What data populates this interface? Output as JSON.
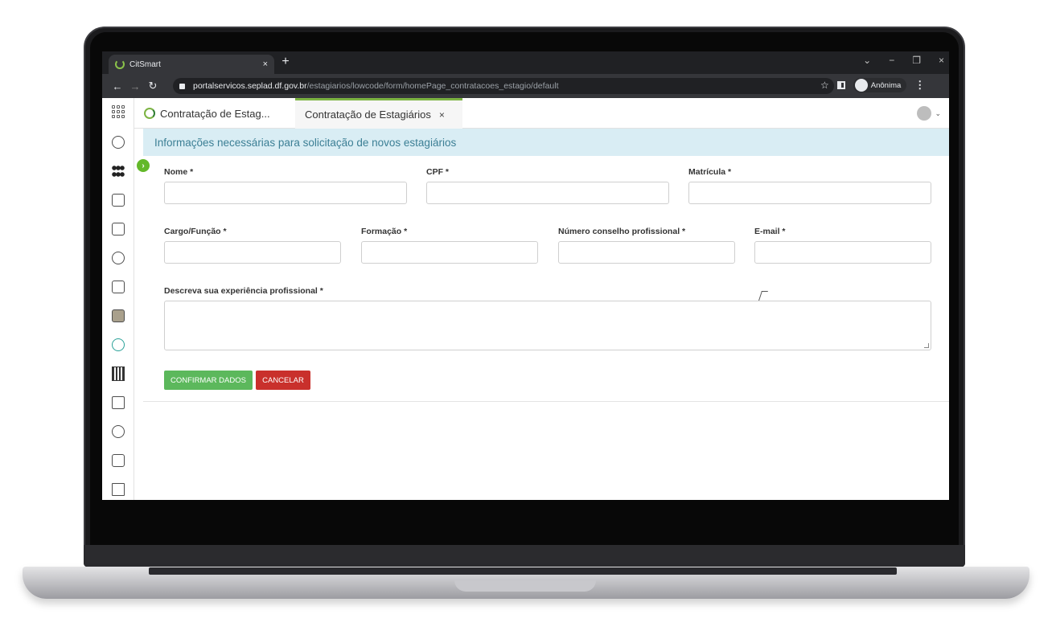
{
  "browser": {
    "tab_title": "CitSmart",
    "tab_close": "×",
    "new_tab": "+",
    "url_host": "portalservicos.seplad.df.gov.br",
    "url_path": "/estagiarios/lowcode/form/homePage_contratacoes_estagio/default",
    "profile_label": "Anônima",
    "window_controls": [
      "⌄",
      "−",
      "❐",
      "×"
    ]
  },
  "app": {
    "home_tab_label": "Contratação de Estag...",
    "active_tab_label": "Contratação de Estagiários",
    "active_tab_close": "×",
    "rail_icons": [
      "apps-grid-icon",
      "people-globe-icon",
      "group-icon",
      "calendar-icon",
      "chart-icon",
      "graduation-cap-icon",
      "donation-icon",
      "money-icon",
      "code-icon",
      "building-icon",
      "layers-icon",
      "users-icon",
      "browser-star-icon",
      "expand-icon"
    ]
  },
  "form": {
    "banner": "Informações necessárias para solicitação de novos estagiários",
    "nome_label": "Nome *",
    "cpf_label": "CPF *",
    "matricula_label": "Matrícula *",
    "cargo_label": "Cargo/Função *",
    "formacao_label": "Formação *",
    "conselho_label": "Número conselho profissional *",
    "email_label": "E-mail *",
    "experiencia_label": "Descreva sua experiência profissional *",
    "nome_value": "",
    "cpf_value": "",
    "matricula_value": "",
    "cargo_value": "",
    "formacao_value": "",
    "conselho_value": "",
    "email_value": "",
    "experiencia_value": "",
    "confirm_button": "CONFIRMAR DADOS",
    "cancel_button": "CANCELAR"
  },
  "colors": {
    "accent_green": "#5cb85c",
    "danger_red": "#c9302c",
    "banner_bg": "#d9edf4",
    "banner_text": "#3c7f95"
  }
}
